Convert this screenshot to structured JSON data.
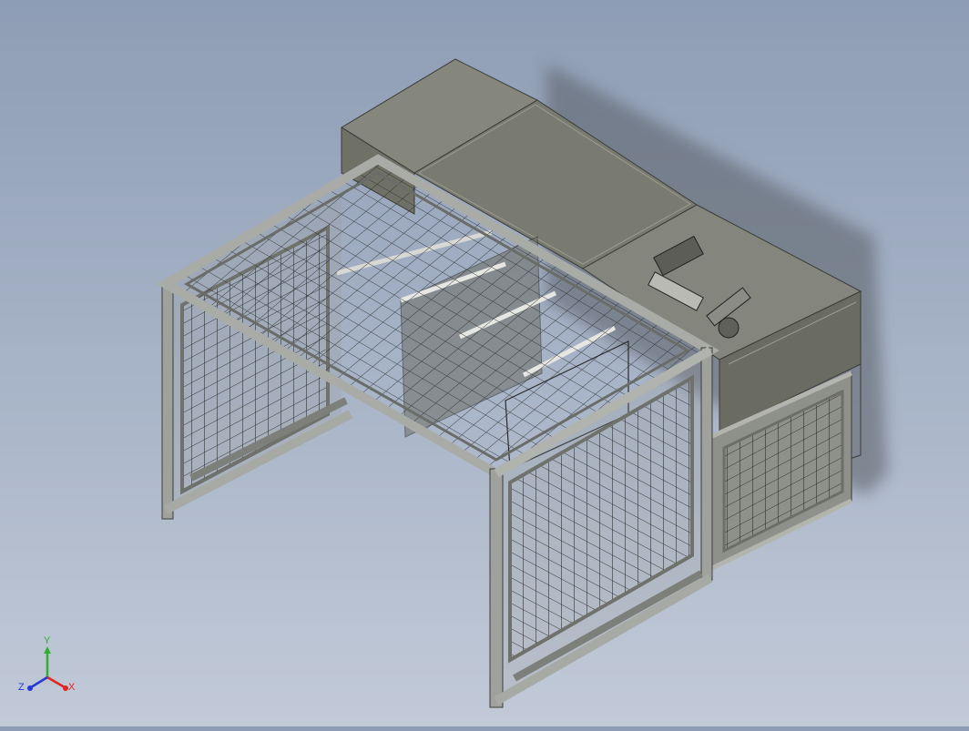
{
  "viewport": {
    "background_top": "#8e9db5",
    "background_bottom": "#c2cad8",
    "model_body_color": "#6f7066",
    "frame_color": "#9a9c98",
    "mesh_color": "#2a2c2c"
  },
  "triad": {
    "x_label": "X",
    "y_label": "Y",
    "z_label": "Z",
    "x_color": "#e0261e",
    "y_color": "#2fae2f",
    "z_color": "#2638d8"
  }
}
